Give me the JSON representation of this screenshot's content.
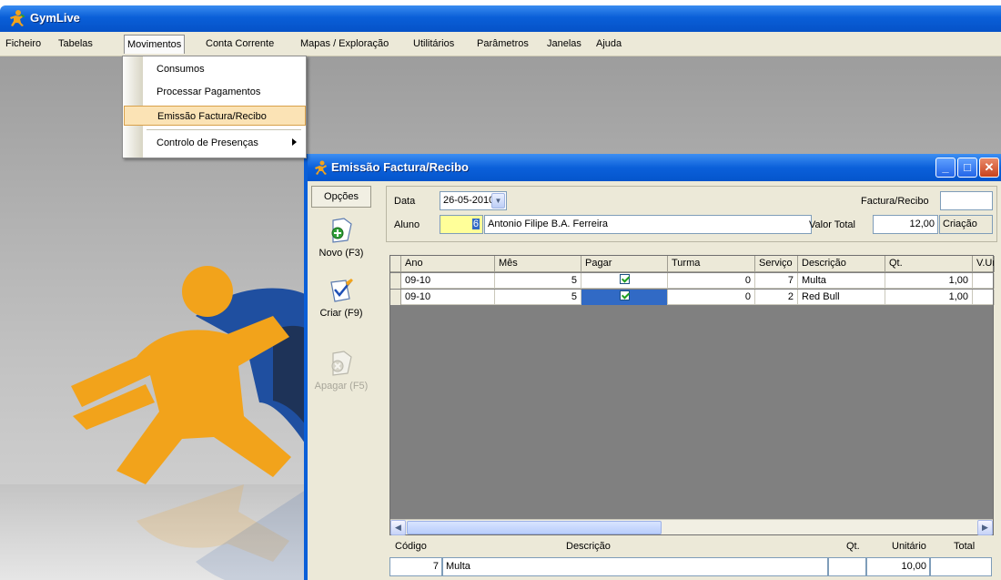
{
  "app": {
    "title": "GymLive"
  },
  "menubar": {
    "items": [
      "Ficheiro",
      "Tabelas",
      "Movimentos",
      "Conta Corrente",
      "Mapas / Exploração",
      "Utilitários",
      "Parâmetros",
      "Janelas",
      "Ajuda"
    ],
    "active": "Movimentos"
  },
  "dropdown": {
    "items": [
      "Consumos",
      "Processar Pagamentos",
      "Emissão Factura/Recibo",
      "Controlo de Presenças"
    ],
    "highlighted": "Emissão Factura/Recibo"
  },
  "window": {
    "title": "Emissão Factura/Recibo",
    "options": {
      "header": "Opções",
      "buttons": [
        {
          "label": "Novo (F3)",
          "enabled": true,
          "icon": "new-document-icon"
        },
        {
          "label": "Criar (F9)",
          "enabled": true,
          "icon": "edit-pencil-icon"
        },
        {
          "label": "Apagar (F5)",
          "enabled": false,
          "icon": "delete-document-icon"
        }
      ]
    },
    "header": {
      "data_label": "Data",
      "data_value": "26-05-2010",
      "aluno_label": "Aluno",
      "aluno_code": "6",
      "aluno_name": "Antonio Filipe B.A. Ferreira",
      "factura_label": "Factura/Recibo",
      "factura_value": "",
      "valor_label": "Valor Total",
      "valor_value": "12,00",
      "status": "Criação"
    },
    "grid": {
      "columns": [
        "Ano",
        "Mês",
        "Pagar",
        "Turma",
        "Serviço",
        "Descrição",
        "Qt.",
        "V.Ur"
      ],
      "rows": [
        {
          "ano": "09-10",
          "mes": "5",
          "pagar": true,
          "turma": "0",
          "servico": "7",
          "descricao": "Multa",
          "qt": "1,00",
          "vun": ""
        },
        {
          "ano": "09-10",
          "mes": "5",
          "pagar": true,
          "turma": "0",
          "servico": "2",
          "descricao": "Red Bull",
          "qt": "1,00",
          "vun": ""
        }
      ]
    },
    "detail": {
      "labels": {
        "codigo": "Código",
        "descricao": "Descrição",
        "qt": "Qt.",
        "unitario": "Unitário",
        "total": "Total"
      },
      "codigo": "7",
      "descricao": "Multa",
      "qt": "",
      "unitario": "10,00",
      "total": ""
    }
  },
  "colors": {
    "titlebar": "#0a5fd8",
    "menu_highlight": "#fbe3b5",
    "field_highlight": "#ffff99",
    "grid_selection": "#316ac5",
    "background_art_blue": "#1f4fa0",
    "background_art_orange": "#f2a31b"
  }
}
